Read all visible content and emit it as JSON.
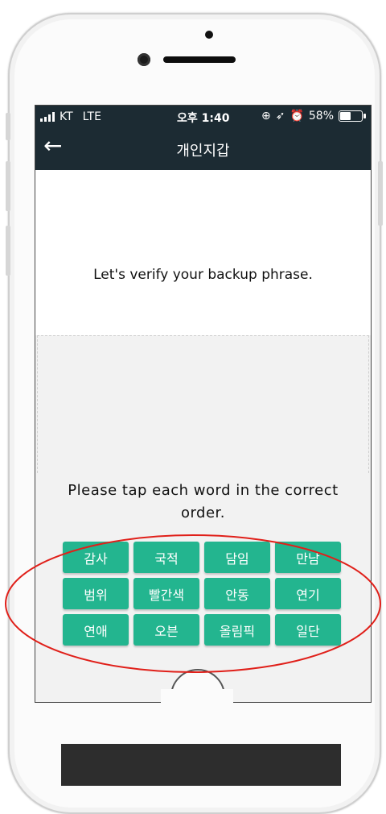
{
  "status_bar": {
    "carrier": "KT",
    "network": "LTE",
    "time": "오후 1:40",
    "status_icons": [
      "orientation-lock-icon",
      "location-icon",
      "alarm-icon"
    ],
    "battery": "58%",
    "battery_level": 0.58
  },
  "nav": {
    "title": "개인지갑",
    "back_icon": "back-arrow-icon"
  },
  "main": {
    "verify_text": "Let's verify your backup phrase.",
    "instruction": "Please tap each word in the correct order."
  },
  "words": [
    "감사",
    "국적",
    "담임",
    "만남",
    "범위",
    "빨간색",
    "안동",
    "연기",
    "연애",
    "오븐",
    "올림픽",
    "일단"
  ],
  "colors": {
    "header": "#1c2b33",
    "word_button": "#23b58f",
    "annotation": "#e0201a"
  }
}
